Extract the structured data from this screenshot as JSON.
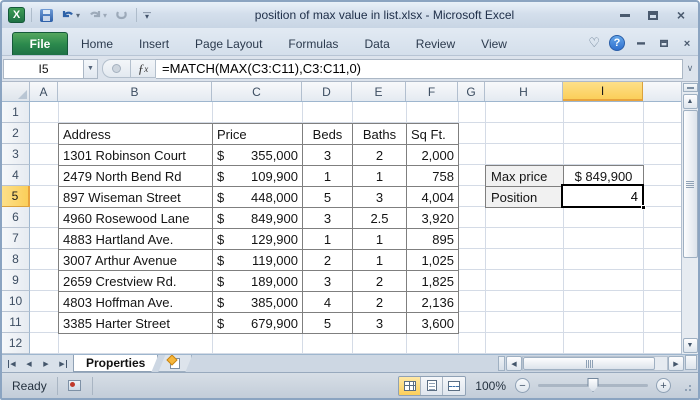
{
  "window": {
    "title": "position of max value in list.xlsx - Microsoft Excel",
    "qat_icons": [
      "excel-logo",
      "save",
      "undo",
      "redo",
      "repeat",
      "customize-quick-access-toolbar"
    ],
    "controls": [
      "minimize",
      "restore",
      "close"
    ]
  },
  "ribbon": {
    "file_tab": "File",
    "tabs": [
      "Home",
      "Insert",
      "Page Layout",
      "Formulas",
      "Data",
      "Review",
      "View"
    ],
    "right_icons": [
      "heart",
      "help",
      "minimize-window",
      "restore-window",
      "close-window"
    ]
  },
  "formula_bar": {
    "name_box": "I5",
    "fx_label": "ƒ",
    "fx_sub": "x",
    "formula": "=MATCH(MAX(C3:C11),C3:C11,0)"
  },
  "grid": {
    "col_headers": [
      "A",
      "B",
      "C",
      "D",
      "E",
      "F",
      "G",
      "H",
      "I"
    ],
    "row_headers": [
      "1",
      "2",
      "3",
      "4",
      "5",
      "6",
      "7",
      "8",
      "9",
      "10",
      "11",
      "12"
    ],
    "selected_cell": "I5",
    "table": {
      "currency": "$",
      "headers": {
        "address": "Address",
        "price": "Price",
        "beds": "Beds",
        "baths": "Baths",
        "sqft": "Sq Ft."
      },
      "rows": [
        {
          "address": "1301 Robinson Court",
          "price": "355,000",
          "beds": "3",
          "baths": "2",
          "sqft": "2,000"
        },
        {
          "address": "2479 North Bend Rd",
          "price": "109,900",
          "beds": "1",
          "baths": "1",
          "sqft": "758"
        },
        {
          "address": "897 Wiseman Street",
          "price": "448,000",
          "beds": "5",
          "baths": "3",
          "sqft": "4,004"
        },
        {
          "address": "4960 Rosewood Lane",
          "price": "849,900",
          "beds": "3",
          "baths": "2.5",
          "sqft": "3,920"
        },
        {
          "address": "4883 Hartland Ave.",
          "price": "129,900",
          "beds": "1",
          "baths": "1",
          "sqft": "895"
        },
        {
          "address": "3007 Arthur Avenue",
          "price": "119,000",
          "beds": "2",
          "baths": "1",
          "sqft": "1,025"
        },
        {
          "address": "2659 Crestview Rd.",
          "price": "189,000",
          "beds": "3",
          "baths": "2",
          "sqft": "1,825"
        },
        {
          "address": "4803 Hoffman Ave.",
          "price": "385,000",
          "beds": "4",
          "baths": "2",
          "sqft": "2,136"
        },
        {
          "address": "3385 Harter Street",
          "price": "679,900",
          "beds": "5",
          "baths": "3",
          "sqft": "3,600"
        }
      ]
    },
    "side_table": {
      "max_label": "Max price",
      "max_value": "$ 849,900",
      "pos_label": "Position",
      "pos_value": "4"
    }
  },
  "sheet_bar": {
    "active_tab": "Properties"
  },
  "status_bar": {
    "mode": "Ready",
    "zoom_level": "100%",
    "zoom_out": "−",
    "zoom_in": "+"
  }
}
